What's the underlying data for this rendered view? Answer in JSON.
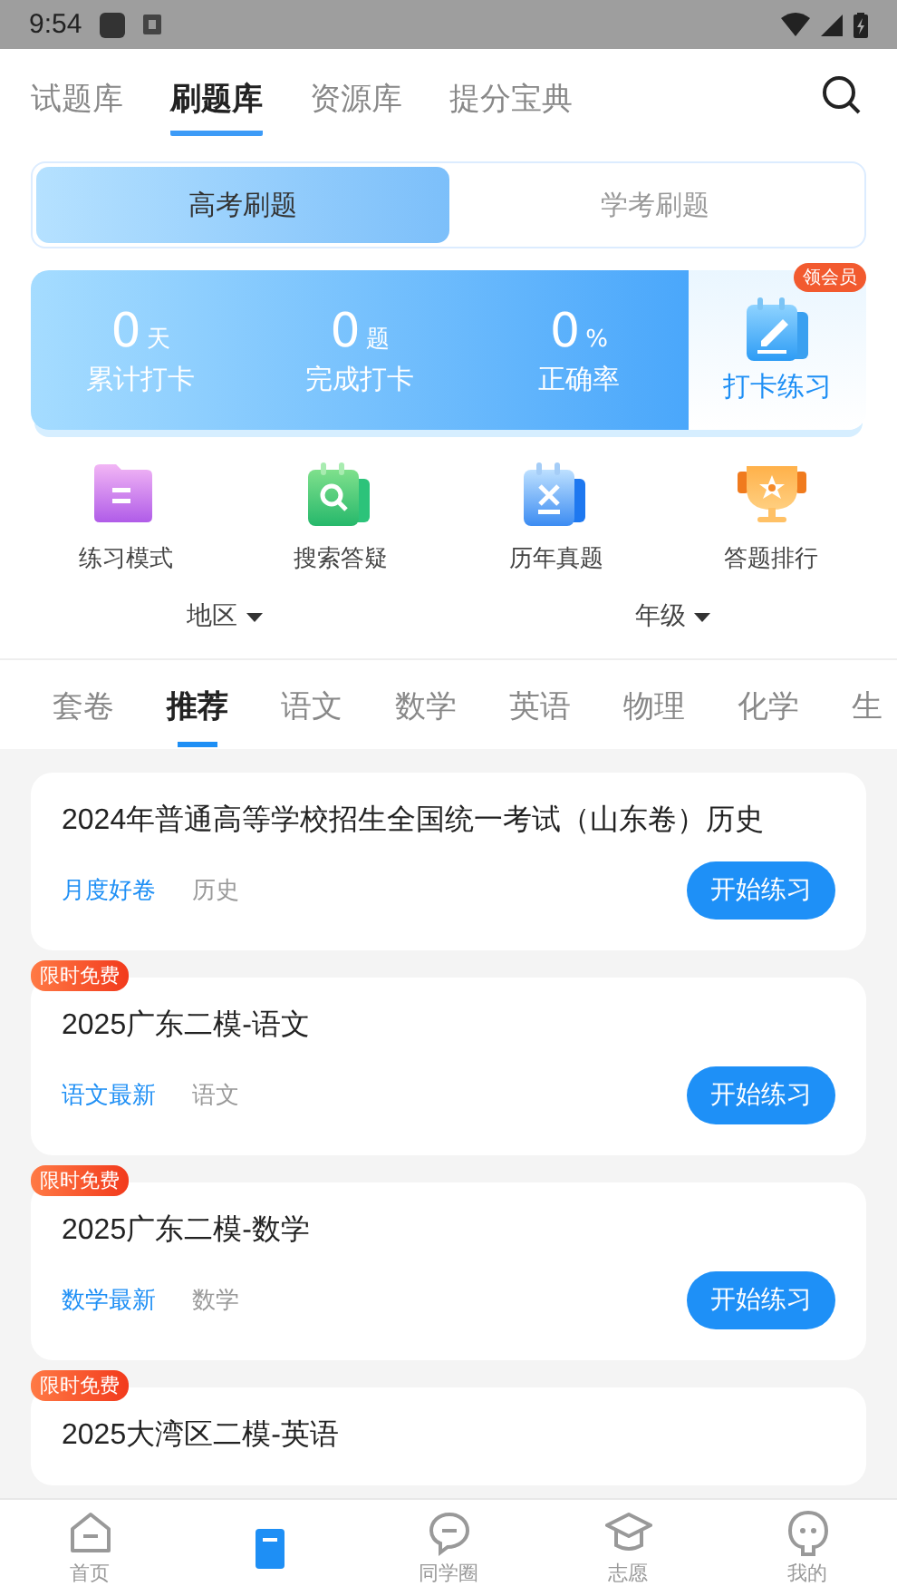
{
  "status_bar": {
    "time": "9:54"
  },
  "top_tabs": [
    {
      "label": "试题库",
      "selected": false
    },
    {
      "label": "刷题库",
      "selected": true
    },
    {
      "label": "资源库",
      "selected": false
    },
    {
      "label": "提分宝典",
      "selected": false
    }
  ],
  "segments": [
    {
      "label": "高考刷题",
      "selected": true
    },
    {
      "label": "学考刷题",
      "selected": false
    }
  ],
  "stats": [
    {
      "value": "0",
      "unit": "天",
      "label": "累计打卡"
    },
    {
      "value": "0",
      "unit": "题",
      "label": "完成打卡"
    },
    {
      "value": "0",
      "unit": "%",
      "label": "正确率"
    }
  ],
  "checkin": {
    "label": "打卡练习",
    "badge": "领会员"
  },
  "features": [
    {
      "kind": "folder",
      "label": "练习模式"
    },
    {
      "kind": "search",
      "label": "搜索答疑"
    },
    {
      "kind": "exam",
      "label": "历年真题"
    },
    {
      "kind": "trophy",
      "label": "答题排行"
    }
  ],
  "filters": [
    "地区",
    "年级"
  ],
  "subjects": [
    {
      "label": "套卷",
      "selected": false
    },
    {
      "label": "推荐",
      "selected": true
    },
    {
      "label": "语文",
      "selected": false
    },
    {
      "label": "数学",
      "selected": false
    },
    {
      "label": "英语",
      "selected": false
    },
    {
      "label": "物理",
      "selected": false
    },
    {
      "label": "化学",
      "selected": false
    },
    {
      "label": "生",
      "selected": false
    }
  ],
  "papers": [
    {
      "title": "2024年普通高等学校招生全国统一考试（山东卷）历史",
      "tag": "月度好卷",
      "subject": "历史",
      "button": "开始练习"
    },
    {
      "badge": "限时免费",
      "title": "2025广东二模-语文",
      "tag": "语文最新",
      "subject": "语文",
      "button": "开始练习"
    },
    {
      "badge": "限时免费",
      "title": "2025广东二模-数学",
      "tag": "数学最新",
      "subject": "数学",
      "button": "开始练习"
    },
    {
      "badge": "限时免费",
      "title": "2025大湾区二模-英语"
    }
  ],
  "bottom_nav": [
    {
      "kind": "home",
      "label": "首页",
      "selected": false
    },
    {
      "kind": "book",
      "selected": true
    },
    {
      "kind": "chat",
      "label": "同学圈",
      "selected": false
    },
    {
      "kind": "cap",
      "label": "志愿",
      "selected": false
    },
    {
      "kind": "face",
      "label": "我的",
      "selected": false
    }
  ]
}
